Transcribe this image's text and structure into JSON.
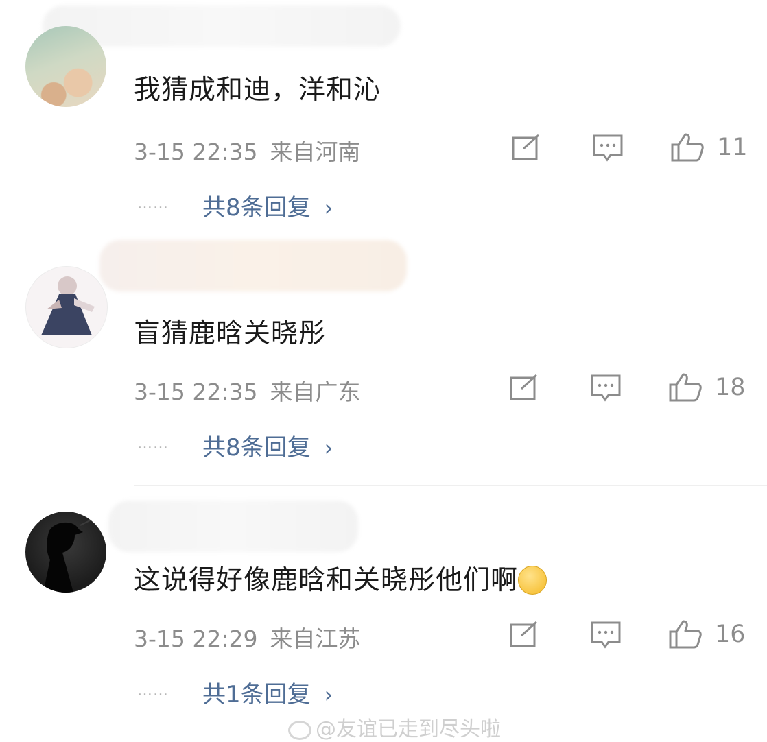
{
  "comments": [
    {
      "text": "我猜成和迪，洋和沁",
      "time": "3-15 22:35",
      "location": "来自河南",
      "likes": "11",
      "dots": "……",
      "replies": "共8条回复",
      "chevron": "›",
      "avatar_icon": "flowers-avatar"
    },
    {
      "text": "盲猜鹿晗关晓彤",
      "time": "3-15 22:35",
      "location": "来自广东",
      "likes": "18",
      "dots": "……",
      "replies": "共8条回复",
      "chevron": "›",
      "avatar_icon": "girl-figure-avatar"
    },
    {
      "text": "这说得好像鹿晗和关晓彤他们啊",
      "time": "3-15 22:29",
      "location": "来自江苏",
      "likes": "16",
      "dots": "……",
      "replies": "共1条回复",
      "chevron": "›",
      "emoji": "blush-smile-emoji",
      "avatar_icon": "silhouette-avatar"
    }
  ],
  "watermark": "@友谊已走到尽头啦",
  "colors": {
    "reply_link": "#4f6d95",
    "meta": "#8c8c8c",
    "text": "#1a1a1a"
  }
}
